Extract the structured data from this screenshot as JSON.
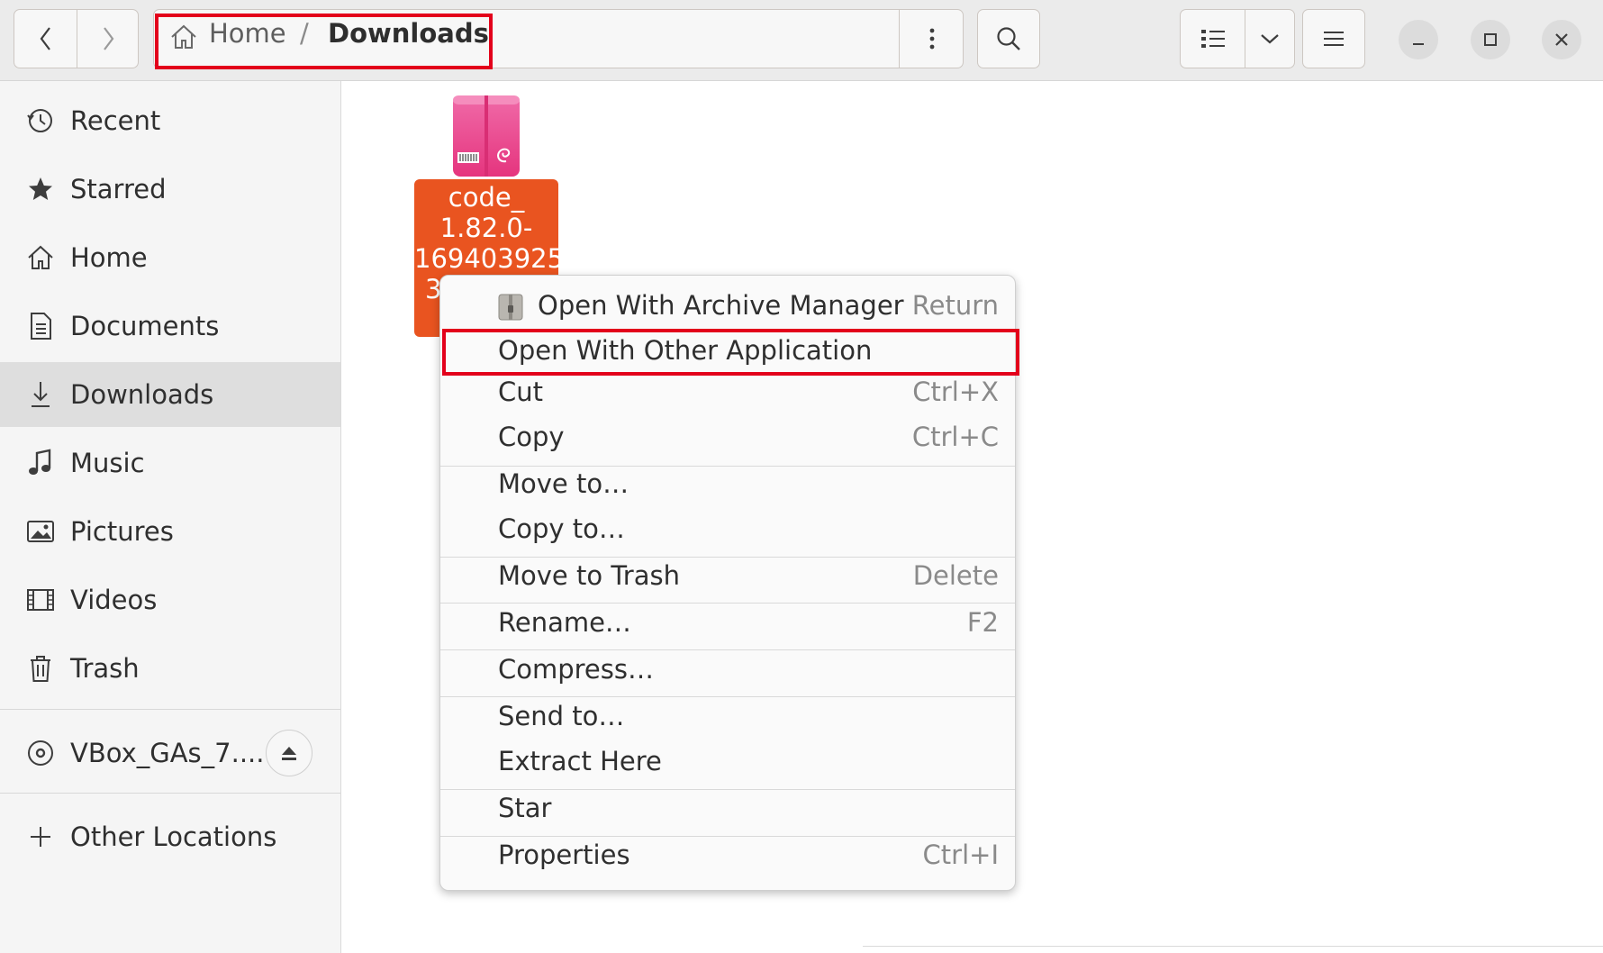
{
  "toolbar": {
    "back_icon": "chevron-left-icon",
    "forward_icon": "chevron-right-icon",
    "path_menu_icon": "vertical-dots-icon",
    "search_icon": "search-icon",
    "view_list_icon": "list-view-icon",
    "view_dropdown_icon": "chevron-down-icon",
    "hamburger_icon": "hamburger-menu-icon"
  },
  "breadcrumb": {
    "home": "Home",
    "separator": "/",
    "current": "Downloads"
  },
  "window_controls": [
    "minimize-icon",
    "maximize-icon",
    "close-icon"
  ],
  "sidebar": {
    "items": [
      {
        "label": "Recent",
        "icon": "clock-icon"
      },
      {
        "label": "Starred",
        "icon": "star-icon"
      },
      {
        "label": "Home",
        "icon": "home-icon"
      },
      {
        "label": "Documents",
        "icon": "document-icon"
      },
      {
        "label": "Downloads",
        "icon": "download-icon",
        "active": true
      },
      {
        "label": "Music",
        "icon": "music-icon"
      },
      {
        "label": "Pictures",
        "icon": "picture-icon"
      },
      {
        "label": "Videos",
        "icon": "video-icon"
      },
      {
        "label": "Trash",
        "icon": "trash-icon"
      }
    ],
    "devices": [
      {
        "label": "VBox_GAs_7....",
        "icon": "disc-icon",
        "action_icon": "eject-icon"
      }
    ],
    "other": {
      "label": "Other Locations",
      "icon": "plus-icon"
    }
  },
  "file": {
    "icon": "debian-package-icon",
    "name_lines": [
      "code_",
      "1.82.0-",
      "169403925",
      "3"
    ]
  },
  "context_menu": {
    "items": [
      {
        "label": "Open With Archive Manager",
        "accel": "Return",
        "icon": "archive-manager-icon"
      },
      {
        "label": "Open With Other Application",
        "accel": ""
      },
      {
        "label": "Cut",
        "accel": "Ctrl+X"
      },
      {
        "label": "Copy",
        "accel": "Ctrl+C"
      },
      {
        "label": "Move to…",
        "accel": ""
      },
      {
        "label": "Copy to…",
        "accel": ""
      },
      {
        "label": "Move to Trash",
        "accel": "Delete"
      },
      {
        "label": "Rename…",
        "accel": "F2"
      },
      {
        "label": "Compress…",
        "accel": ""
      },
      {
        "label": "Send to…",
        "accel": ""
      },
      {
        "label": "Extract Here",
        "accel": ""
      },
      {
        "label": "Star",
        "accel": ""
      },
      {
        "label": "Properties",
        "accel": "Ctrl+I"
      }
    ]
  },
  "colors": {
    "selection": "#e95420",
    "highlight_box": "#e3001b"
  }
}
